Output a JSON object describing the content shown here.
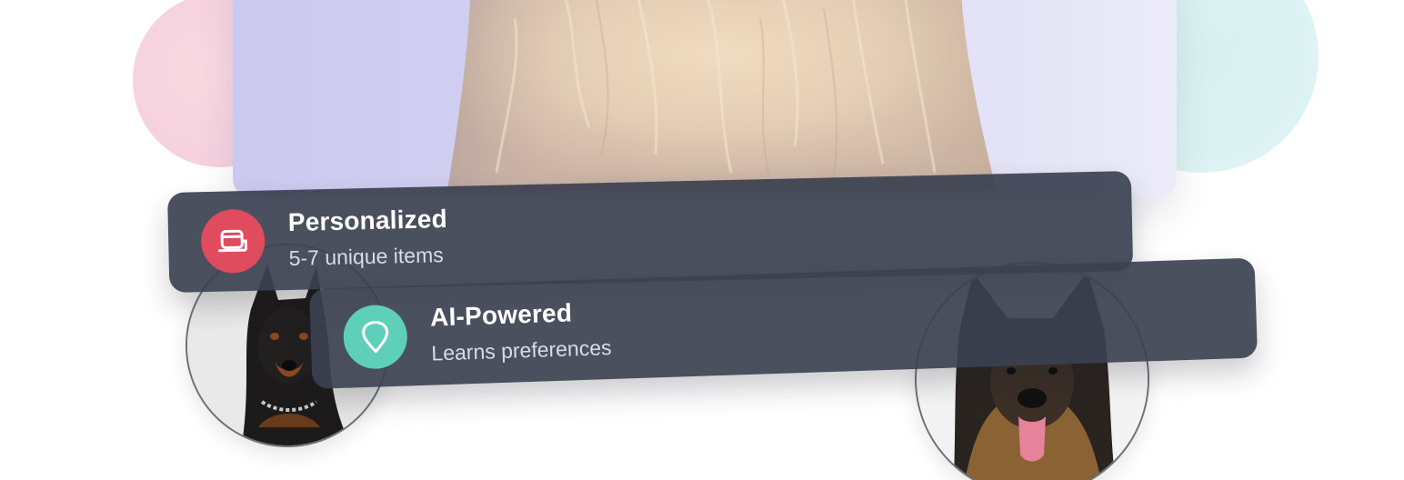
{
  "features": [
    {
      "title": "Personalized",
      "subtitle": "5-7 unique items",
      "icon": "box-icon",
      "color": "#e04b5e"
    },
    {
      "title": "AI-Powered",
      "subtitle": "Learns preferences",
      "icon": "location-pin-icon",
      "color": "#5ecfb8"
    }
  ],
  "images": {
    "hero": "fluffy-dog-photo",
    "left_avatar": "doberman-photo",
    "right_avatar": "german-shepherd-photo"
  },
  "colors": {
    "banner": "#3b4150",
    "pink_blob": "#f3c6d6",
    "teal_blob": "#d3efee",
    "hero_background": "#d2d0f1"
  }
}
